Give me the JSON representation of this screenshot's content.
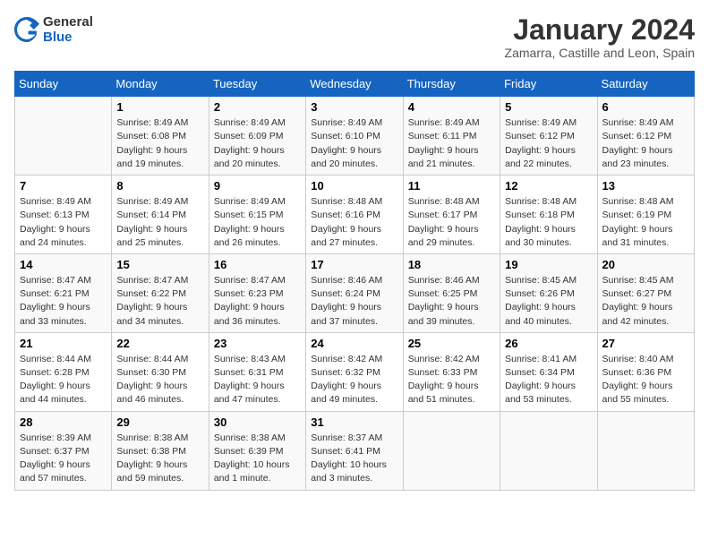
{
  "header": {
    "logo_general": "General",
    "logo_blue": "Blue",
    "month_title": "January 2024",
    "location": "Zamarra, Castille and Leon, Spain"
  },
  "days_of_week": [
    "Sunday",
    "Monday",
    "Tuesday",
    "Wednesday",
    "Thursday",
    "Friday",
    "Saturday"
  ],
  "weeks": [
    [
      {
        "day": "",
        "sunrise": "",
        "sunset": "",
        "daylight": ""
      },
      {
        "day": "1",
        "sunrise": "Sunrise: 8:49 AM",
        "sunset": "Sunset: 6:08 PM",
        "daylight": "Daylight: 9 hours and 19 minutes."
      },
      {
        "day": "2",
        "sunrise": "Sunrise: 8:49 AM",
        "sunset": "Sunset: 6:09 PM",
        "daylight": "Daylight: 9 hours and 20 minutes."
      },
      {
        "day": "3",
        "sunrise": "Sunrise: 8:49 AM",
        "sunset": "Sunset: 6:10 PM",
        "daylight": "Daylight: 9 hours and 20 minutes."
      },
      {
        "day": "4",
        "sunrise": "Sunrise: 8:49 AM",
        "sunset": "Sunset: 6:11 PM",
        "daylight": "Daylight: 9 hours and 21 minutes."
      },
      {
        "day": "5",
        "sunrise": "Sunrise: 8:49 AM",
        "sunset": "Sunset: 6:12 PM",
        "daylight": "Daylight: 9 hours and 22 minutes."
      },
      {
        "day": "6",
        "sunrise": "Sunrise: 8:49 AM",
        "sunset": "Sunset: 6:12 PM",
        "daylight": "Daylight: 9 hours and 23 minutes."
      }
    ],
    [
      {
        "day": "7",
        "sunrise": "Sunrise: 8:49 AM",
        "sunset": "Sunset: 6:13 PM",
        "daylight": "Daylight: 9 hours and 24 minutes."
      },
      {
        "day": "8",
        "sunrise": "Sunrise: 8:49 AM",
        "sunset": "Sunset: 6:14 PM",
        "daylight": "Daylight: 9 hours and 25 minutes."
      },
      {
        "day": "9",
        "sunrise": "Sunrise: 8:49 AM",
        "sunset": "Sunset: 6:15 PM",
        "daylight": "Daylight: 9 hours and 26 minutes."
      },
      {
        "day": "10",
        "sunrise": "Sunrise: 8:48 AM",
        "sunset": "Sunset: 6:16 PM",
        "daylight": "Daylight: 9 hours and 27 minutes."
      },
      {
        "day": "11",
        "sunrise": "Sunrise: 8:48 AM",
        "sunset": "Sunset: 6:17 PM",
        "daylight": "Daylight: 9 hours and 29 minutes."
      },
      {
        "day": "12",
        "sunrise": "Sunrise: 8:48 AM",
        "sunset": "Sunset: 6:18 PM",
        "daylight": "Daylight: 9 hours and 30 minutes."
      },
      {
        "day": "13",
        "sunrise": "Sunrise: 8:48 AM",
        "sunset": "Sunset: 6:19 PM",
        "daylight": "Daylight: 9 hours and 31 minutes."
      }
    ],
    [
      {
        "day": "14",
        "sunrise": "Sunrise: 8:47 AM",
        "sunset": "Sunset: 6:21 PM",
        "daylight": "Daylight: 9 hours and 33 minutes."
      },
      {
        "day": "15",
        "sunrise": "Sunrise: 8:47 AM",
        "sunset": "Sunset: 6:22 PM",
        "daylight": "Daylight: 9 hours and 34 minutes."
      },
      {
        "day": "16",
        "sunrise": "Sunrise: 8:47 AM",
        "sunset": "Sunset: 6:23 PM",
        "daylight": "Daylight: 9 hours and 36 minutes."
      },
      {
        "day": "17",
        "sunrise": "Sunrise: 8:46 AM",
        "sunset": "Sunset: 6:24 PM",
        "daylight": "Daylight: 9 hours and 37 minutes."
      },
      {
        "day": "18",
        "sunrise": "Sunrise: 8:46 AM",
        "sunset": "Sunset: 6:25 PM",
        "daylight": "Daylight: 9 hours and 39 minutes."
      },
      {
        "day": "19",
        "sunrise": "Sunrise: 8:45 AM",
        "sunset": "Sunset: 6:26 PM",
        "daylight": "Daylight: 9 hours and 40 minutes."
      },
      {
        "day": "20",
        "sunrise": "Sunrise: 8:45 AM",
        "sunset": "Sunset: 6:27 PM",
        "daylight": "Daylight: 9 hours and 42 minutes."
      }
    ],
    [
      {
        "day": "21",
        "sunrise": "Sunrise: 8:44 AM",
        "sunset": "Sunset: 6:28 PM",
        "daylight": "Daylight: 9 hours and 44 minutes."
      },
      {
        "day": "22",
        "sunrise": "Sunrise: 8:44 AM",
        "sunset": "Sunset: 6:30 PM",
        "daylight": "Daylight: 9 hours and 46 minutes."
      },
      {
        "day": "23",
        "sunrise": "Sunrise: 8:43 AM",
        "sunset": "Sunset: 6:31 PM",
        "daylight": "Daylight: 9 hours and 47 minutes."
      },
      {
        "day": "24",
        "sunrise": "Sunrise: 8:42 AM",
        "sunset": "Sunset: 6:32 PM",
        "daylight": "Daylight: 9 hours and 49 minutes."
      },
      {
        "day": "25",
        "sunrise": "Sunrise: 8:42 AM",
        "sunset": "Sunset: 6:33 PM",
        "daylight": "Daylight: 9 hours and 51 minutes."
      },
      {
        "day": "26",
        "sunrise": "Sunrise: 8:41 AM",
        "sunset": "Sunset: 6:34 PM",
        "daylight": "Daylight: 9 hours and 53 minutes."
      },
      {
        "day": "27",
        "sunrise": "Sunrise: 8:40 AM",
        "sunset": "Sunset: 6:36 PM",
        "daylight": "Daylight: 9 hours and 55 minutes."
      }
    ],
    [
      {
        "day": "28",
        "sunrise": "Sunrise: 8:39 AM",
        "sunset": "Sunset: 6:37 PM",
        "daylight": "Daylight: 9 hours and 57 minutes."
      },
      {
        "day": "29",
        "sunrise": "Sunrise: 8:38 AM",
        "sunset": "Sunset: 6:38 PM",
        "daylight": "Daylight: 9 hours and 59 minutes."
      },
      {
        "day": "30",
        "sunrise": "Sunrise: 8:38 AM",
        "sunset": "Sunset: 6:39 PM",
        "daylight": "Daylight: 10 hours and 1 minute."
      },
      {
        "day": "31",
        "sunrise": "Sunrise: 8:37 AM",
        "sunset": "Sunset: 6:41 PM",
        "daylight": "Daylight: 10 hours and 3 minutes."
      },
      {
        "day": "",
        "sunrise": "",
        "sunset": "",
        "daylight": ""
      },
      {
        "day": "",
        "sunrise": "",
        "sunset": "",
        "daylight": ""
      },
      {
        "day": "",
        "sunrise": "",
        "sunset": "",
        "daylight": ""
      }
    ]
  ]
}
